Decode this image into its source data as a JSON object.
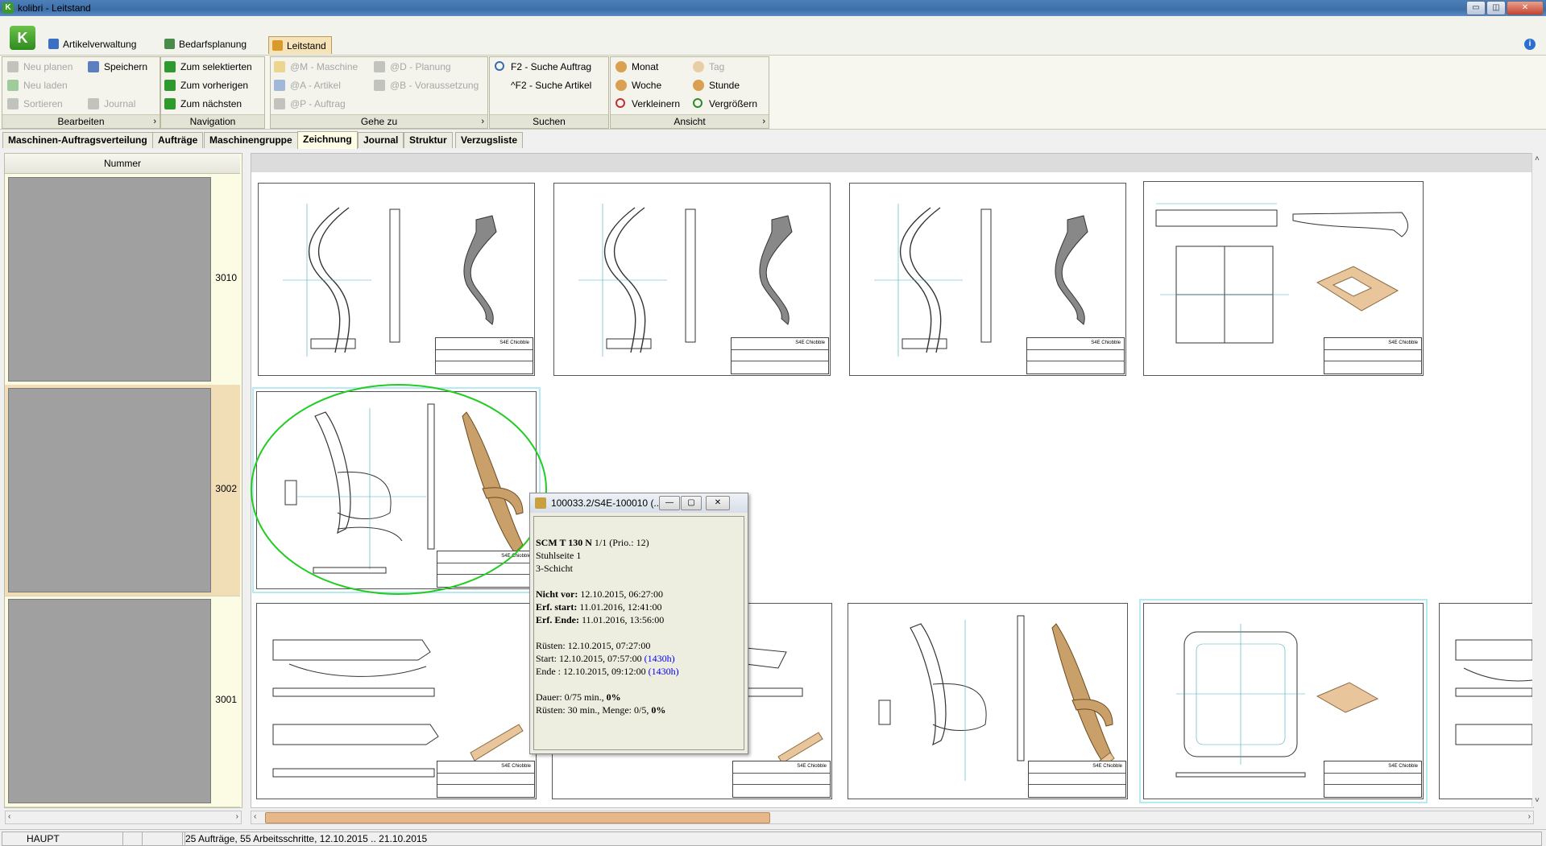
{
  "window": {
    "title": "kolibri - Leitstand",
    "min": "▭",
    "max": "◫",
    "close": "✕"
  },
  "ribbon_tabs": [
    {
      "label": "Artikelverwaltung"
    },
    {
      "label": "Bedarfsplanung"
    },
    {
      "label": "Leitstand"
    }
  ],
  "groups": {
    "bearbeiten": {
      "caption": "Bearbeiten",
      "items": [
        "Neu planen",
        "Speichern",
        "Neu laden",
        "Sortieren",
        "Journal"
      ]
    },
    "navigation": {
      "caption": "Navigation",
      "items": [
        "Zum selektierten",
        "Zum vorherigen",
        "Zum nächsten"
      ]
    },
    "gehezu": {
      "caption": "Gehe zu",
      "items": [
        "@M - Maschine",
        "@D - Planung",
        "@A - Artikel",
        "@B - Voraussetzung",
        "@P - Auftrag"
      ]
    },
    "suchen": {
      "caption": "Suchen",
      "items": [
        "F2 - Suche Auftrag",
        "^F2 - Suche Artikel"
      ]
    },
    "ansicht": {
      "caption": "Ansicht",
      "items": [
        "Monat",
        "Tag",
        "Woche",
        "Stunde",
        "Verkleinern",
        "Vergrößern"
      ]
    }
  },
  "content_tabs": [
    "Maschinen-Auftragsverteilung",
    "Aufträge",
    "Maschinengruppe",
    "Zeichnung",
    "Journal",
    "Struktur",
    "Verzugsliste"
  ],
  "left": {
    "column_header": "Nummer",
    "rows": [
      "3010",
      "3002",
      "3001"
    ]
  },
  "title_block_text": "S4E Chiobble",
  "popup": {
    "title": "100033.2/S4E-100010 (...",
    "machine": "SCM T 130 N",
    "machine_rest": " 1/1 (Prio.: 12)",
    "part": "Stuhlseite 1",
    "shift": "3-Schicht",
    "nicht_vor_label": "Nicht vor:",
    "nicht_vor_value": " 12.10.2015, 06:27:00",
    "erf_start_label": "Erf. start:",
    "erf_start_value": " 11.01.2016, 12:41:00",
    "erf_ende_label": "Erf. Ende:",
    "erf_ende_value": " 11.01.2016, 13:56:00",
    "ruesten": "Rüsten: 12.10.2015, 07:27:00",
    "start": "Start: 12.10.2015, 07:57:00 ",
    "start_h": "(1430h)",
    "ende": "Ende : 12.10.2015, 09:12:00 ",
    "ende_h": "(1430h)",
    "dauer": "Dauer: 0/75 min., ",
    "dauer_pct": "0%",
    "ruesten_menge": "Rüsten: 30 min., Menge: 0/5, ",
    "ruesten_pct": "0%"
  },
  "status": {
    "mode": "HAUPT",
    "summary": "25 Aufträge, 55 Arbeitsschritte, 12.10.2015 .. 21.10.2015"
  },
  "colors": {
    "selected_row": "#f1deb7",
    "highlight_ellipse": "#22cc22",
    "link_blue": "#0000ee",
    "scroll_thumb": "#e7b98a"
  }
}
